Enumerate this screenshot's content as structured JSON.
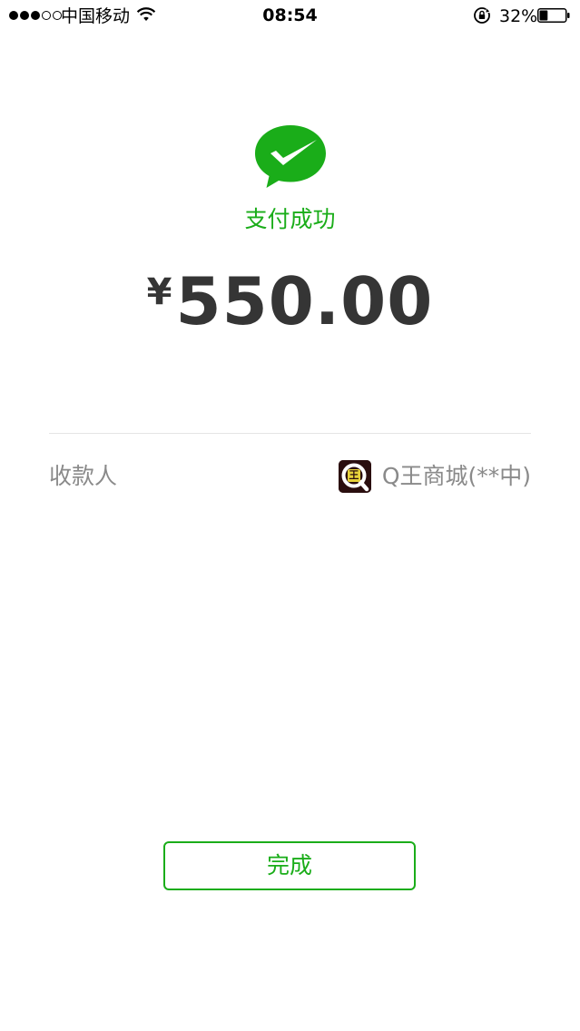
{
  "status_bar": {
    "signal_filled": 3,
    "signal_empty": 2,
    "carrier": "中国移动",
    "time": "08:54",
    "battery_percent": "32%",
    "battery_level": 0.32
  },
  "payment": {
    "status_text": "支付成功",
    "currency_symbol": "¥",
    "amount": "550.00"
  },
  "payee": {
    "label": "收款人",
    "merchant_name": "Q王商城(**中)",
    "merchant_logo_char": "王"
  },
  "actions": {
    "done_label": "完成"
  },
  "colors": {
    "accent": "#1aad19",
    "amount_text": "#353535",
    "secondary_text": "#8a8a8a"
  },
  "icons": {
    "logo": "wechat-pay-logo-icon",
    "wifi": "wifi-icon",
    "rotation_lock": "rotation-lock-icon",
    "battery": "battery-icon"
  }
}
